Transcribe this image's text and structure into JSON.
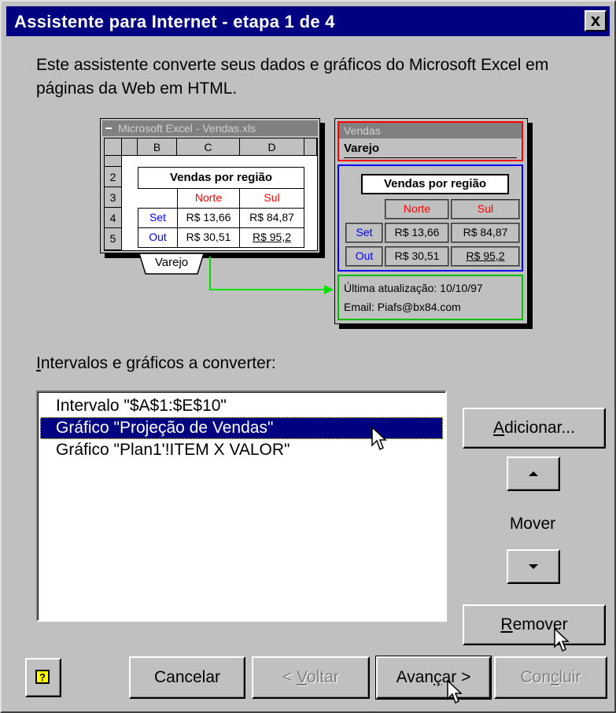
{
  "window": {
    "title": "Assistente para Internet - etapa 1 de 4",
    "close_symbol": "x"
  },
  "intro": "Este assistente converte seus dados e gráficos do Microsoft Excel em páginas da Web em HTML.",
  "illustration": {
    "excel": {
      "title": "Microsoft Excel - Vendas.xls",
      "col_headers": [
        "B",
        "C",
        "D"
      ],
      "row_headers": [
        "2",
        "3",
        "4",
        "5"
      ],
      "table_title": "Vendas por região",
      "regions": [
        "Norte",
        "Sul"
      ],
      "rows": [
        {
          "label": "Set",
          "norte": "R$ 13,66",
          "sul": "R$ 84,87"
        },
        {
          "label": "Out",
          "norte": "R$ 30,51",
          "sul": "R$ 95,2"
        }
      ],
      "sheet_tab": "Varejo"
    },
    "web": {
      "header": "Vendas",
      "subtitle": "Varejo",
      "table_title": "Vendas por região",
      "regions": [
        "Norte",
        "Sul"
      ],
      "rows": [
        {
          "label": "Set",
          "norte": "R$ 13,66",
          "sul": "R$ 84,87"
        },
        {
          "label": "Out",
          "norte": "R$ 30,51",
          "sul": "R$ 95,2"
        }
      ],
      "last_update": "Última atualização: 10/10/97",
      "email": "Email: Piafs@bx84.com"
    },
    "colors": {
      "header_box": "#ff0000",
      "table_box": "#0000ff",
      "footer_box": "#00c000",
      "arrow": "#00e000"
    }
  },
  "list": {
    "label_first": "I",
    "label_rest": "ntervalos e gráficos a converter:",
    "items": [
      "Intervalo \"$A$1:$E$10\"",
      "Gráfico \"Projeção de Vendas\"",
      "Gráfico \"Plan1'!ITEM X VALOR\""
    ],
    "selected_index": 1
  },
  "side_buttons": {
    "add_first": "A",
    "add_rest": "dicionar...",
    "move_label": "Mover",
    "remove_first": "R",
    "remove_rest": "emover"
  },
  "footer_buttons": {
    "help_icon": "help-icon",
    "cancel": "Cancelar",
    "back_pre": "< ",
    "back_u": "V",
    "back_rest": "oltar",
    "next_pre": "Avan",
    "next_u": "ç",
    "next_rest": "ar >",
    "finish_pre": "Con",
    "finish_u": "c",
    "finish_rest": "luir"
  }
}
